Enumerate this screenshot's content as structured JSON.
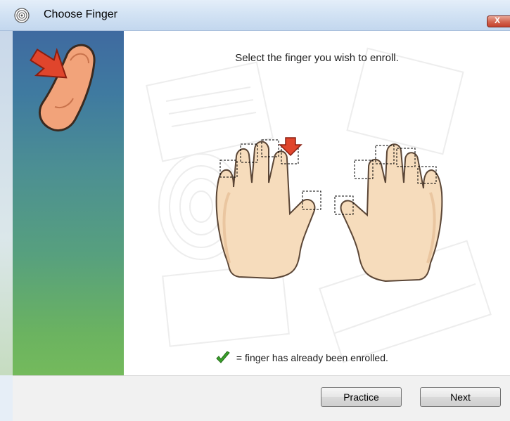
{
  "window": {
    "title": "Choose Finger",
    "close_label": "X"
  },
  "content": {
    "instruction": "Select the finger you wish to enroll.",
    "legend_text": "= finger has already been enrolled."
  },
  "buttons": {
    "practice": "Practice",
    "next": "Next"
  },
  "icons": {
    "app": "fingerprint-icon",
    "sidebar": "finger-press-arrow-icon",
    "legend": "checkmark-icon",
    "selection": "red-down-arrow-icon"
  },
  "colors": {
    "sidebar_top": "#3f6aa0",
    "sidebar_bottom": "#74ba5c",
    "accent_red": "#e0452c",
    "check_green": "#3aa12b"
  }
}
